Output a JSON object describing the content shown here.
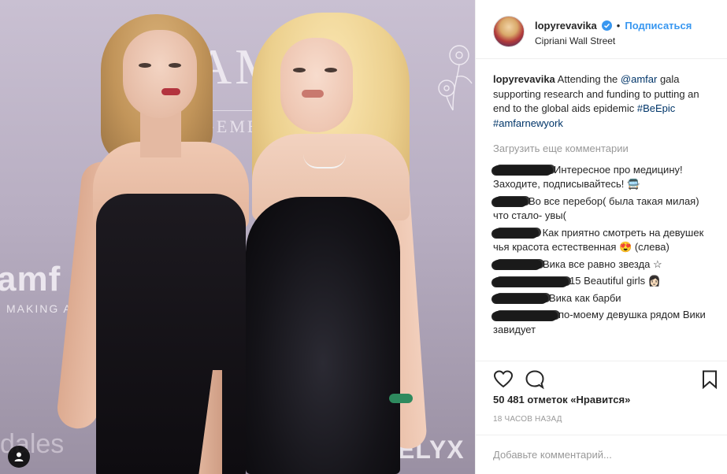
{
  "post": {
    "username": "lopyrevavika",
    "follow_label": "Подписаться",
    "separator": "•",
    "location": "Cipriani Wall Street",
    "caption": {
      "user": "lopyrevavika",
      "text_1": " Attending the ",
      "mention": "@amfar",
      "text_2": " gala supporting research and funding to putting an end to the global aids epidemic ",
      "tag_1": "#BeEpic",
      "tag_2": "#amfarnewyork"
    },
    "load_more": "Загрузить еще комментарии",
    "comments": [
      {
        "text": "Интересное про медицину! Заходите, подписывайтесь! 🚍"
      },
      {
        "text": "Во все перебор( была такая милая) что стало- увы("
      },
      {
        "text": " Как приятно смотреть на девушек чья красота естественная 😍 (слева)"
      },
      {
        "text": "Вика все равно звезда ☆"
      },
      {
        "text": "15 Beautiful girls 👩🏻"
      },
      {
        "text": "Вика как барби"
      },
      {
        "text": "по-моему девушка рядом Вики завидует"
      }
    ],
    "likes": "50 481 отметок «Нравится»",
    "timestamp": "18 ЧАСОВ НАЗАД",
    "add_comment_placeholder": "Добавьте комментарий..."
  },
  "photo_text": {
    "amp": "AMP",
    "gement": "GEMENT",
    "amfar": "amf",
    "making": "MAKING AIDS",
    "dales": "dales",
    "lyx": "ELYX"
  },
  "colors": {
    "link": "#003569",
    "accent": "#3897f0",
    "muted": "#999999"
  },
  "icons": [
    "verified-icon",
    "heart-icon",
    "comment-icon",
    "bookmark-icon",
    "user-tag-icon"
  ]
}
